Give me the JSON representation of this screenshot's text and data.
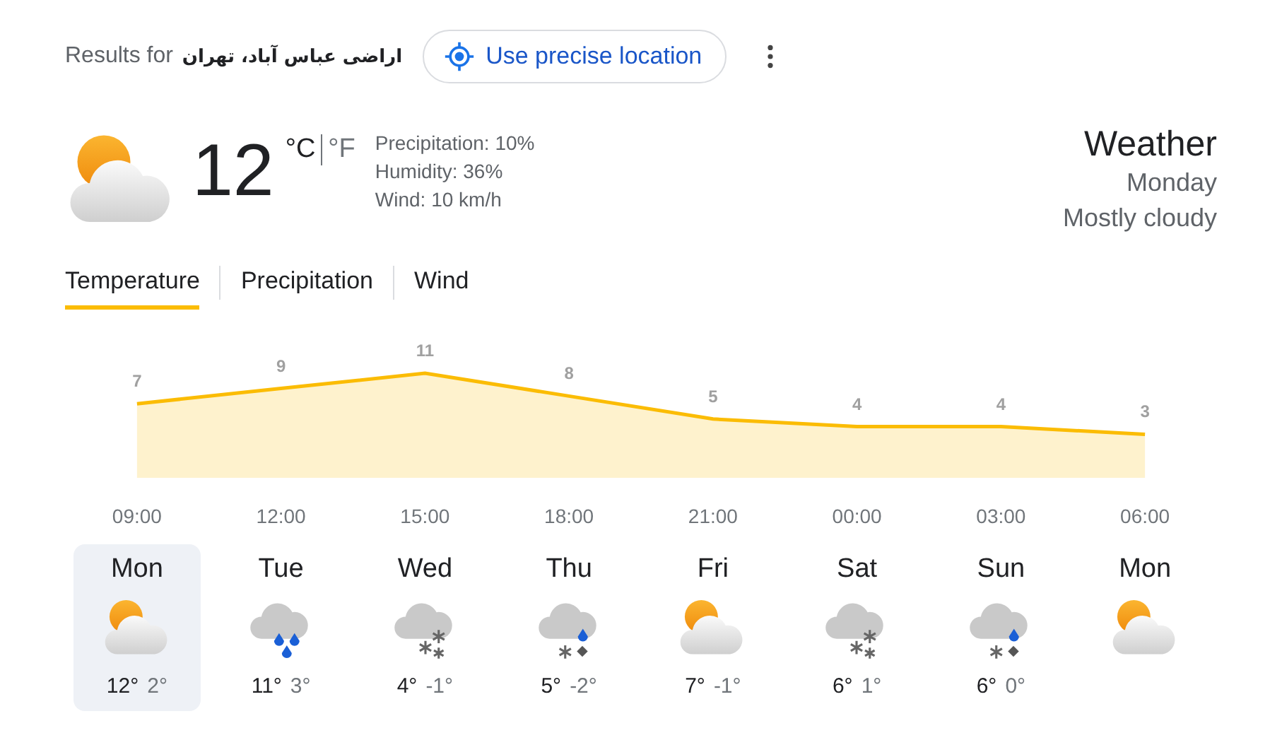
{
  "header": {
    "results_prefix": "Results for",
    "location": "اراضی عباس آباد، تهران",
    "precise_location_button": "Use precise location"
  },
  "current": {
    "kind": "partly-cloudy",
    "temperature": "12",
    "units": [
      {
        "label": "°C",
        "selected": true
      },
      {
        "label": "°F",
        "selected": false
      }
    ],
    "details": [
      "Precipitation: 10%",
      "Humidity: 36%",
      "Wind: 10 km/h"
    ],
    "title": "Weather",
    "day": "Monday",
    "condition": "Mostly cloudy"
  },
  "tabs": [
    {
      "label": "Temperature",
      "selected": true
    },
    {
      "label": "Precipitation",
      "selected": false
    },
    {
      "label": "Wind",
      "selected": false
    }
  ],
  "chart_data": {
    "type": "area",
    "categories": [
      "09:00",
      "12:00",
      "15:00",
      "18:00",
      "21:00",
      "00:00",
      "03:00",
      "06:00"
    ],
    "series": [
      {
        "color": "#fbbc04",
        "values": [
          7,
          9,
          11,
          8,
          5,
          4,
          4,
          3
        ]
      }
    ],
    "data_labels": true
  },
  "days": [
    {
      "name": "Mon",
      "kind": "partly-cloudy",
      "high": "12°",
      "low": "2°",
      "selected": true
    },
    {
      "name": "Tue",
      "kind": "rain",
      "high": "11°",
      "low": "3°",
      "selected": false
    },
    {
      "name": "Wed",
      "kind": "snow",
      "high": "4°",
      "low": "-1°",
      "selected": false
    },
    {
      "name": "Thu",
      "kind": "mixed",
      "high": "5°",
      "low": "-2°",
      "selected": false
    },
    {
      "name": "Fri",
      "kind": "partly-cloudy",
      "high": "7°",
      "low": "-1°",
      "selected": false
    },
    {
      "name": "Sat",
      "kind": "snow",
      "high": "6°",
      "low": "1°",
      "selected": false
    },
    {
      "name": "Sun",
      "kind": "mixed",
      "high": "6°",
      "low": "0°",
      "selected": false
    },
    {
      "name": "Mon",
      "kind": "partly-cloudy",
      "selected": false
    }
  ]
}
